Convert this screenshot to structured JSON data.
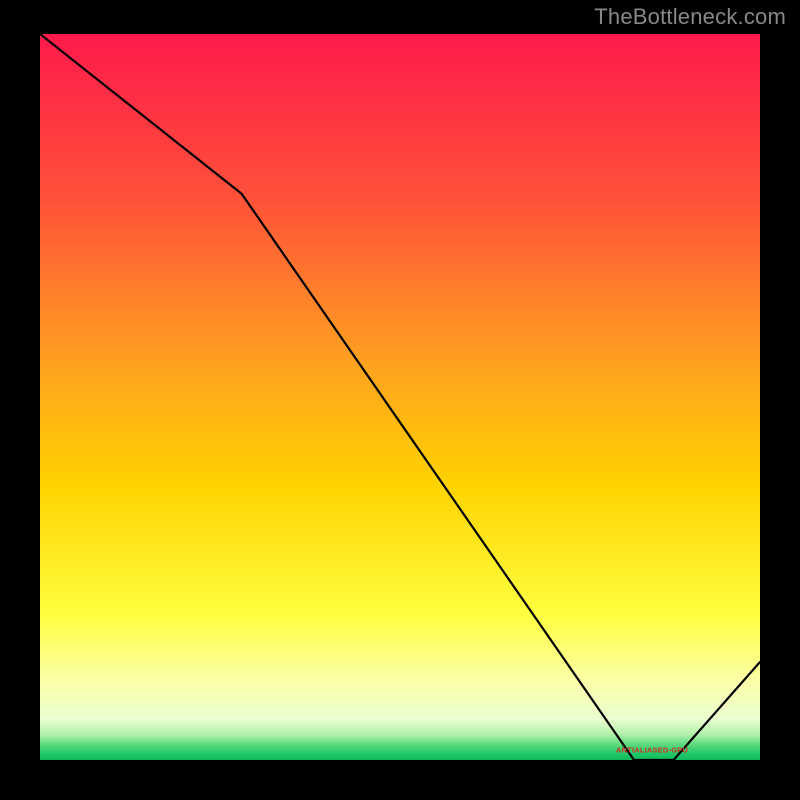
{
  "watermark": "TheBottleneck.com",
  "annotation_label": "ANTIALIASED-GPU",
  "chart_data": {
    "type": "line",
    "title": "",
    "xlabel": "",
    "ylabel": "",
    "xlim": [
      0,
      100
    ],
    "ylim": [
      0,
      100
    ],
    "x": [
      0,
      28,
      82.5,
      88,
      100
    ],
    "values": [
      100,
      78,
      0,
      0,
      13.5
    ],
    "annotation": {
      "x": 85,
      "y": 1.4,
      "text_key": "annotation_label"
    },
    "gradient_stops": [
      {
        "offset": 0.0,
        "color": "#ff1a4b"
      },
      {
        "offset": 0.22,
        "color": "#ff4f3a"
      },
      {
        "offset": 0.45,
        "color": "#ffa020"
      },
      {
        "offset": 0.62,
        "color": "#ffd200"
      },
      {
        "offset": 0.8,
        "color": "#ffff40"
      },
      {
        "offset": 0.9,
        "color": "#fbffb0"
      },
      {
        "offset": 0.945,
        "color": "#e8ffd0"
      },
      {
        "offset": 0.965,
        "color": "#b0f0a8"
      },
      {
        "offset": 0.98,
        "color": "#55d87a"
      },
      {
        "offset": 0.992,
        "color": "#1ec86a"
      },
      {
        "offset": 1.0,
        "color": "#0fb85a"
      }
    ]
  }
}
